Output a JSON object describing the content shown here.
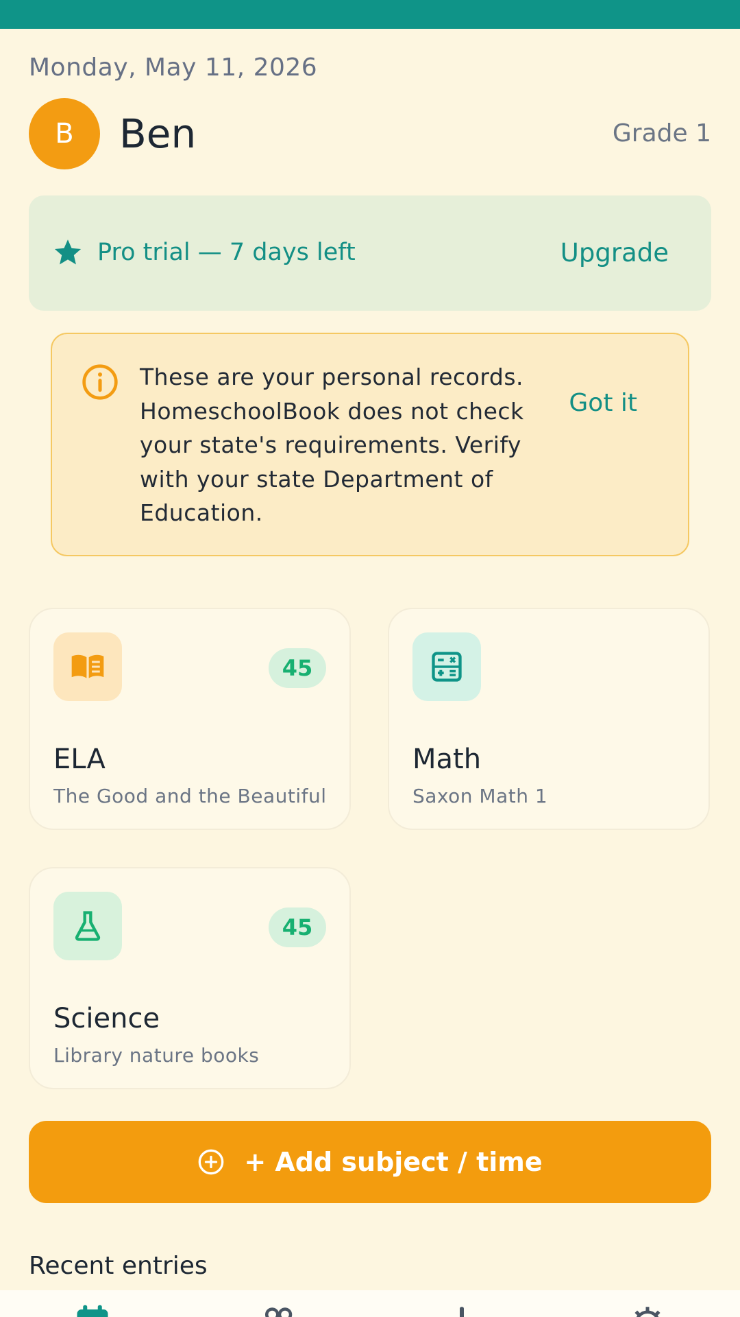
{
  "header": {
    "date": "Monday, May 11, 2026",
    "avatar_initial": "B",
    "child_name": "Ben",
    "grade": "Grade 1"
  },
  "trial_banner": {
    "text": "Pro trial — 7 days left",
    "action": "Upgrade",
    "icon": "star-icon"
  },
  "notice": {
    "text": "These are your personal records. HomeschoolBook does not check your state's requirements. Verify with your state Department of Education.",
    "action": "Got it",
    "icon": "info-icon"
  },
  "subjects": [
    {
      "title": "ELA",
      "subtitle": "The Good and the Beautiful",
      "badge": "45",
      "icon": "book-icon"
    },
    {
      "title": "Math",
      "subtitle": "Saxon Math 1",
      "badge": "",
      "icon": "calculator-icon"
    },
    {
      "title": "Science",
      "subtitle": "Library nature books",
      "badge": "45",
      "icon": "flask-icon"
    }
  ],
  "add_button": {
    "label": "+ Add subject / time",
    "icon": "plus-circle-icon"
  },
  "recent": {
    "title": "Recent entries"
  },
  "bottom_nav": [
    {
      "icon": "calendar-icon",
      "active": true
    },
    {
      "icon": "people-icon",
      "active": false
    },
    {
      "icon": "chart-icon",
      "active": false
    },
    {
      "icon": "gear-icon",
      "active": false
    }
  ],
  "colors": {
    "teal": "#0f9488",
    "orange": "#f39c12",
    "background": "#fdf6e0",
    "badge_green": "#17b071"
  }
}
